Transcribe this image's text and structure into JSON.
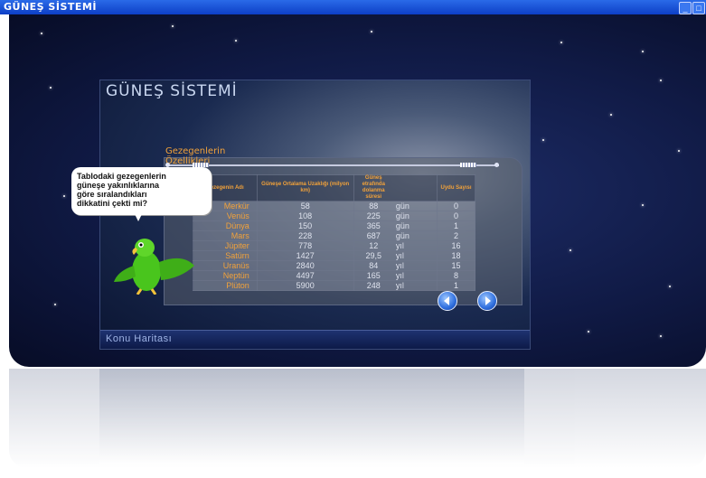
{
  "window": {
    "title": "GÜNEŞ SİSTEMİ"
  },
  "panel": {
    "title": "GÜNEŞ SİSTEMİ",
    "section_title_line1": "Gezegenlerin",
    "section_title_line2": "Özellikleri",
    "map_link": "Konu Haritası"
  },
  "speech_bubble": {
    "line1": "Tablodaki gezegenlerin",
    "line2": "güneşe yakınlıklarına",
    "line3": "göre sıralandıkları",
    "line4": "dikkatini çekti mi?"
  },
  "table": {
    "headers": {
      "planet": "Gezegenin Adı",
      "distance": "Güneşe Ortalama Uzaklığı (milyon km)",
      "period": "Güneş etrafında dolanma süresi",
      "moons": "Uydu Sayısı"
    },
    "rows": [
      {
        "name": "Merkür",
        "distance": "58",
        "period": "88",
        "unit": "gün",
        "moons": "0"
      },
      {
        "name": "Venüs",
        "distance": "108",
        "period": "225",
        "unit": "gün",
        "moons": "0"
      },
      {
        "name": "Dünya",
        "distance": "150",
        "period": "365",
        "unit": "gün",
        "moons": "1"
      },
      {
        "name": "Mars",
        "distance": "228",
        "period": "687",
        "unit": "gün",
        "moons": "2"
      },
      {
        "name": "Jüpiter",
        "distance": "778",
        "period": "12",
        "unit": "yıl",
        "moons": "16"
      },
      {
        "name": "Satürn",
        "distance": "1427",
        "period": "29,5",
        "unit": "yıl",
        "moons": "18"
      },
      {
        "name": "Uranüs",
        "distance": "2840",
        "period": "84",
        "unit": "yıl",
        "moons": "15"
      },
      {
        "name": "Neptün",
        "distance": "4497",
        "period": "165",
        "unit": "yıl",
        "moons": "8"
      },
      {
        "name": "Plüton",
        "distance": "5900",
        "period": "248",
        "unit": "yıl",
        "moons": "1"
      }
    ]
  },
  "icons": {
    "prev": "arrow-left-icon",
    "next": "arrow-right-icon",
    "minimize": "minimize-icon",
    "maximize": "maximize-icon",
    "mascot": "parrot-icon"
  },
  "colors": {
    "accent": "#f2a23a",
    "titlebar": "#0d3fc7",
    "space": "#101a45"
  }
}
